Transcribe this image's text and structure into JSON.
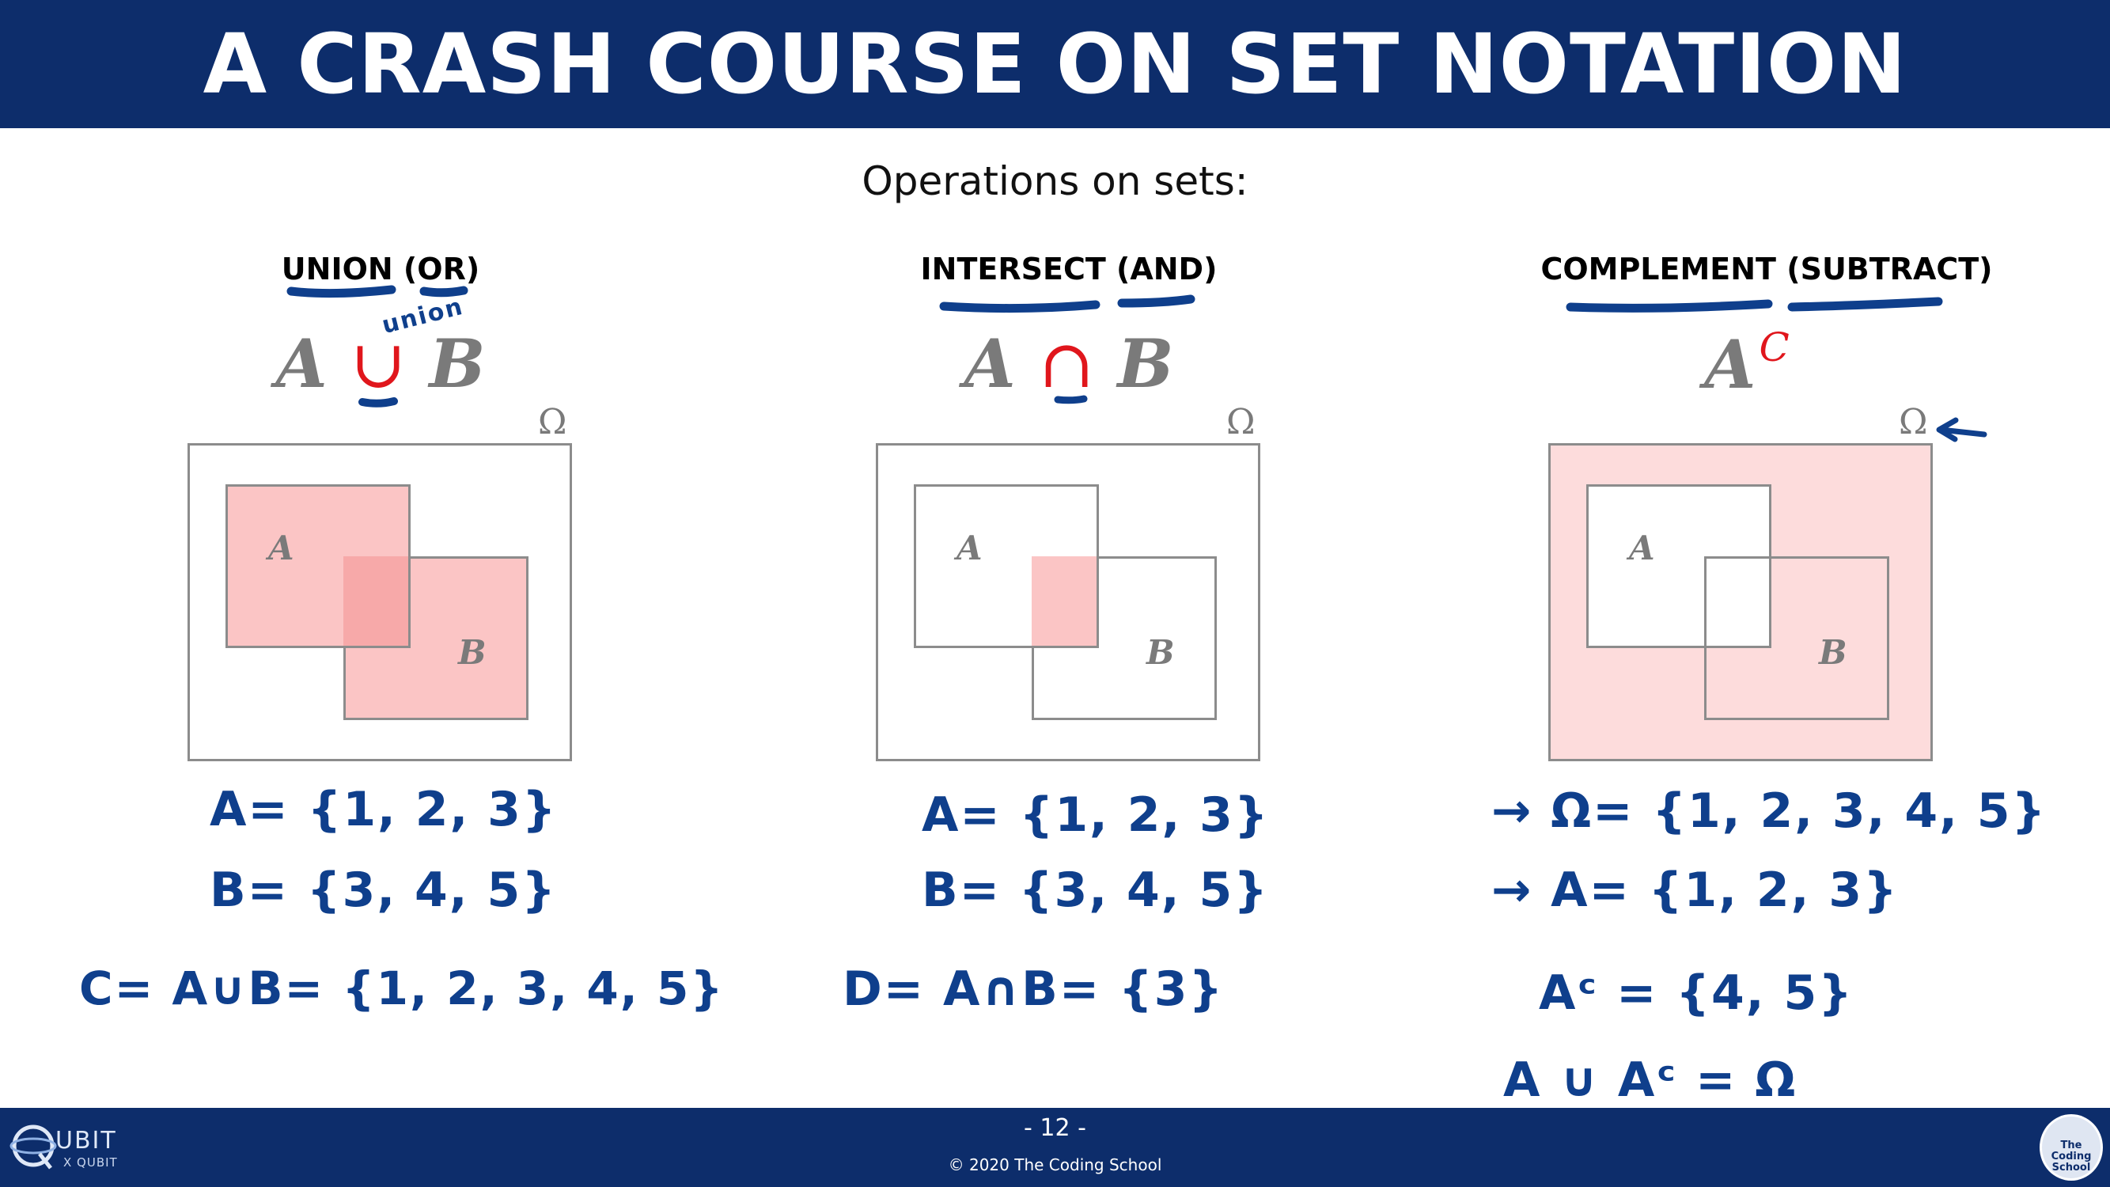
{
  "header": {
    "title": "A CRASH COURSE ON SET NOTATION"
  },
  "subtitle": "Operations on sets:",
  "columns": [
    {
      "title": "UNION (OR)",
      "set_a": "A",
      "operator": "∪",
      "set_b": "B",
      "omega": "Ω",
      "label_a": "A",
      "label_b": "B",
      "annotation": "union"
    },
    {
      "title": "INTERSECT (AND)",
      "set_a": "A",
      "operator": "∩",
      "set_b": "B",
      "omega": "Ω",
      "label_a": "A",
      "label_b": "B"
    },
    {
      "title": "COMPLEMENT (SUBTRACT)",
      "set_a": "A",
      "superscript": "C",
      "omega": "Ω",
      "label_a": "A",
      "label_b": "B"
    }
  ],
  "handwriting": {
    "union": [
      "A= {1, 2, 3}",
      "B= {3, 4, 5}",
      "C= A∪B= {1, 2, 3, 4, 5}"
    ],
    "intersect": [
      "A= {1, 2, 3}",
      "B= {3, 4, 5}",
      "D= A∩B= {3}"
    ],
    "complement": [
      "→ Ω= {1, 2, 3, 4, 5}",
      "→ A= {1, 2, 3}",
      "Aᶜ = {4, 5}",
      "A ∪ Aᶜ = Ω"
    ]
  },
  "footer": {
    "page": "- 12 -",
    "copyright": "© 2020 The Coding School"
  },
  "logos": {
    "left_brand": "UBIT",
    "left_sub": "X QUBIT",
    "right_text": "The Coding School"
  },
  "colors": {
    "header_bg": "#0d2d6b",
    "ink": "#0f3f8c",
    "operator_red": "#e0161c",
    "set_fill": "#fbc5c5"
  }
}
